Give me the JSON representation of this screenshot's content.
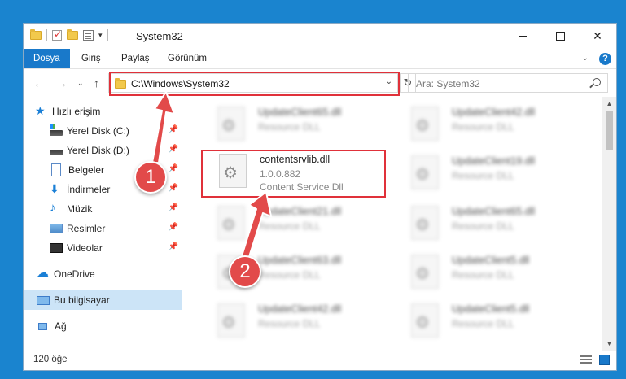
{
  "window": {
    "title": "System32"
  },
  "ribbon": {
    "tabs": [
      "Dosya",
      "Giriş",
      "Paylaş",
      "Görünüm"
    ]
  },
  "nav": {
    "address": "C:\\Windows\\System32",
    "search_placeholder": "Ara: System32"
  },
  "sidebar": {
    "items": [
      {
        "label": "Hızlı erişim",
        "icon": "star-icon"
      },
      {
        "label": "Yerel Disk (C:)",
        "icon": "disk-icon",
        "pinned": true
      },
      {
        "label": "Yerel Disk (D:)",
        "icon": "disk-icon",
        "pinned": true
      },
      {
        "label": "Belgeler",
        "icon": "document-icon",
        "pinned": true
      },
      {
        "label": "İndirmeler",
        "icon": "download-icon",
        "pinned": true
      },
      {
        "label": "Müzik",
        "icon": "music-icon",
        "pinned": true
      },
      {
        "label": "Resimler",
        "icon": "pictures-icon",
        "pinned": true
      },
      {
        "label": "Videolar",
        "icon": "video-icon",
        "pinned": true
      },
      {
        "label": "OneDrive",
        "icon": "cloud-icon"
      },
      {
        "label": "Bu bilgisayar",
        "icon": "computer-icon",
        "selected": true
      },
      {
        "label": "Ağ",
        "icon": "network-icon"
      }
    ]
  },
  "files": {
    "highlighted": {
      "name": "contentsrvlib.dll",
      "version": "1.0.0.882",
      "desc": "Content Service Dll"
    },
    "left": [
      {
        "name": "UpdateClient65.dll",
        "desc": "Resource DLL"
      },
      {
        "name": "UpdateClient21.dll",
        "desc": "Resource DLL"
      },
      {
        "name": "UpdateClient63.dll",
        "desc": "Resource DLL"
      },
      {
        "name": "UpdateClient42.dll",
        "desc": "Resource DLL"
      }
    ],
    "right": [
      {
        "name": "UpdateClient42.dll",
        "desc": "Resource DLL"
      },
      {
        "name": "UpdateClient19.dll",
        "desc": "Resource DLL"
      },
      {
        "name": "UpdateClient65.dll",
        "desc": "Resource DLL"
      },
      {
        "name": "UpdateClient5.dll",
        "desc": "Resource DLL"
      },
      {
        "name": "UpdateClient5.dll",
        "desc": "Resource DLL"
      }
    ]
  },
  "status": {
    "count": "120 öğe"
  },
  "annotations": {
    "badge1": "1",
    "badge2": "2"
  },
  "colors": {
    "accent": "#1979ca",
    "highlight_red": "#e0313a",
    "arrow_red": "#e24a4a"
  }
}
